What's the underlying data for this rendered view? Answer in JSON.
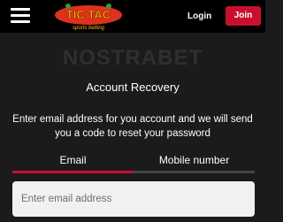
{
  "header": {
    "login_label": "Login",
    "join_label": "Join",
    "logo_text": "TIC TAC",
    "logo_tagline": "sports betting",
    "accent_color": "#c8102e"
  },
  "watermark": "NOSTRABET",
  "recovery": {
    "title": "Account Recovery",
    "description": "Enter email address for you account and we will send you a code to reset your password",
    "tabs": [
      {
        "label": "Email",
        "active": true
      },
      {
        "label": "Mobile number",
        "active": false
      }
    ],
    "email_placeholder": "Enter email address"
  }
}
